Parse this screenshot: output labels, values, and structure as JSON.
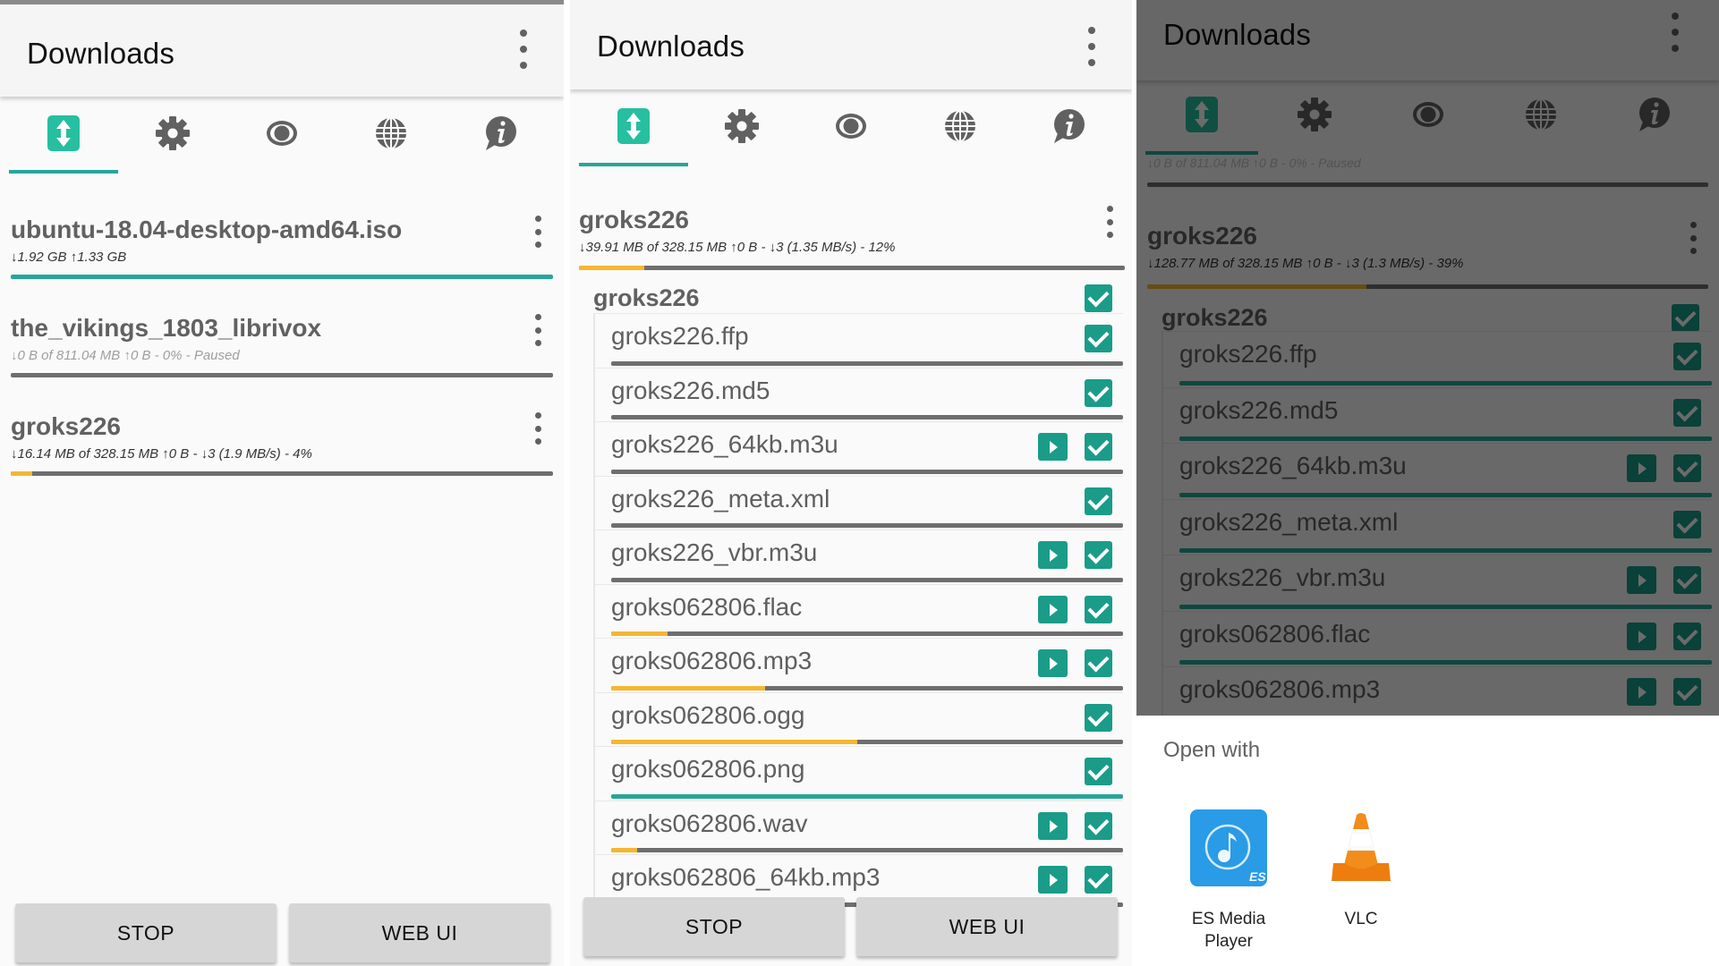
{
  "colors": {
    "accent": "#26a69a",
    "checkbox": "#1a9c89",
    "progress_partial": "#f4b731",
    "progress_track": "#6e6e6e",
    "appbar_bg": "#f5f5f5",
    "button_bg": "#d6d6d6"
  },
  "tabs": [
    {
      "id": "downloads",
      "icon": "transfer-icon",
      "active": true
    },
    {
      "id": "settings",
      "icon": "gear-icon",
      "active": false
    },
    {
      "id": "watch",
      "icon": "eye-icon",
      "active": false
    },
    {
      "id": "network",
      "icon": "globe-icon",
      "active": false
    },
    {
      "id": "about",
      "icon": "info-icon",
      "active": false
    }
  ],
  "panel1": {
    "title": "Downloads",
    "downloads": [
      {
        "name": "ubuntu-18.04-desktop-amd64.iso",
        "status": "↓1.92 GB ↑1.33 GB",
        "progress": 1.0,
        "state": "complete"
      },
      {
        "name": "the_vikings_1803_librivox",
        "status": "↓0 B of 811.04 MB ↑0 B - 0% - Paused",
        "progress": 0.0,
        "state": "paused"
      },
      {
        "name": "groks226",
        "status": "↓16.14 MB of 328.15 MB ↑0 B - ↓3 (1.9 MB/s) - 4%",
        "progress": 0.04,
        "state": "downloading"
      }
    ],
    "buttons": {
      "stop": "STOP",
      "webui": "WEB UI"
    }
  },
  "panel2": {
    "title": "Downloads",
    "torrent": {
      "name": "groks226",
      "status": "↓39.91 MB of 328.15 MB ↑0 B - ↓3 (1.35 MB/s) - 12%",
      "progress": 0.12
    },
    "folder": {
      "name": "groks226",
      "checked": true
    },
    "files": [
      {
        "name": "groks226.ffp",
        "playable": false,
        "checked": true,
        "progress": 0.0
      },
      {
        "name": "groks226.md5",
        "playable": false,
        "checked": true,
        "progress": 0.0
      },
      {
        "name": "groks226_64kb.m3u",
        "playable": true,
        "checked": true,
        "progress": 0.0
      },
      {
        "name": "groks226_meta.xml",
        "playable": false,
        "checked": true,
        "progress": 0.0
      },
      {
        "name": "groks226_vbr.m3u",
        "playable": true,
        "checked": true,
        "progress": 0.0
      },
      {
        "name": "groks062806.flac",
        "playable": true,
        "checked": true,
        "progress": 0.11
      },
      {
        "name": "groks062806.mp3",
        "playable": true,
        "checked": true,
        "progress": 0.3
      },
      {
        "name": "groks062806.ogg",
        "playable": false,
        "checked": true,
        "progress": 0.48
      },
      {
        "name": "groks062806.png",
        "playable": false,
        "checked": true,
        "progress": 1.0
      },
      {
        "name": "groks062806.wav",
        "playable": true,
        "checked": true,
        "progress": 0.05
      },
      {
        "name": "groks062806_64kb.mp3",
        "playable": true,
        "checked": true,
        "progress": 0.0
      }
    ],
    "buttons": {
      "stop": "STOP",
      "webui": "WEB UI"
    }
  },
  "panel3": {
    "title": "Downloads",
    "clipped_status": "↓0 B of 811.04 MB ↑0 B - 0% - Paused",
    "torrent": {
      "name": "groks226",
      "status": "↓128.77 MB of 328.15 MB ↑0 B - ↓3 (1.3 MB/s) - 39%",
      "progress": 0.39
    },
    "folder": {
      "name": "groks226",
      "checked": true
    },
    "files": [
      {
        "name": "groks226.ffp",
        "playable": false,
        "checked": true,
        "progress": 1.0
      },
      {
        "name": "groks226.md5",
        "playable": false,
        "checked": true,
        "progress": 1.0
      },
      {
        "name": "groks226_64kb.m3u",
        "playable": true,
        "checked": true,
        "progress": 1.0
      },
      {
        "name": "groks226_meta.xml",
        "playable": false,
        "checked": true,
        "progress": 1.0
      },
      {
        "name": "groks226_vbr.m3u",
        "playable": true,
        "checked": true,
        "progress": 1.0
      },
      {
        "name": "groks062806.flac",
        "playable": true,
        "checked": true,
        "progress": 1.0
      },
      {
        "name": "groks062806.mp3",
        "playable": true,
        "checked": true,
        "progress": 1.0
      }
    ],
    "open_with": {
      "heading": "Open with",
      "apps": [
        {
          "name": "ES Media\nPlayer",
          "icon": "es-media-player-icon"
        },
        {
          "name": "VLC",
          "icon": "vlc-cone-icon"
        }
      ]
    }
  }
}
